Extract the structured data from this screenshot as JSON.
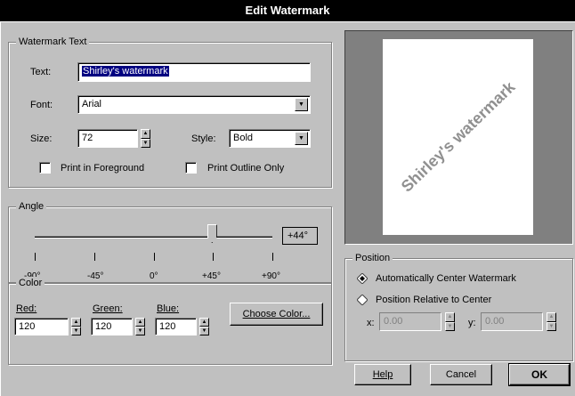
{
  "window": {
    "title": "Edit Watermark"
  },
  "watermark_text": {
    "group_label": "Watermark Text",
    "text_label": "Text:",
    "text_value": "Shirley's watermark",
    "font_label": "Font:",
    "font_value": "Arial",
    "size_label": "Size:",
    "size_value": "72",
    "style_label": "Style:",
    "style_value": "Bold",
    "print_foreground_label": "Print in Foreground",
    "print_foreground_checked": false,
    "print_outline_label": "Print Outline Only",
    "print_outline_checked": false
  },
  "angle": {
    "group_label": "Angle",
    "value_display": "+44°",
    "value": 44,
    "min": -90,
    "max": 90,
    "tick_labels": [
      "-90°",
      "-45°",
      "0°",
      "+45°",
      "+90°"
    ]
  },
  "color": {
    "group_label": "Color",
    "red_label": "Red:",
    "red_value": "120",
    "green_label": "Green:",
    "green_value": "120",
    "blue_label": "Blue:",
    "blue_value": "120",
    "choose_button": "Choose Color..."
  },
  "preview": {
    "text": "Shirley's watermark"
  },
  "position": {
    "group_label": "Position",
    "auto_center_label": "Automatically Center Watermark",
    "relative_label": "Position Relative to Center",
    "selected": "auto_center",
    "x_label": "x:",
    "x_value": "0.00",
    "y_label": "y:",
    "y_value": "0.00"
  },
  "buttons": {
    "help": "Help",
    "cancel": "Cancel",
    "ok": "OK"
  },
  "colors": {
    "title_bg": "#000000",
    "dialog_bg": "#c0c0c0",
    "selection": "#000080",
    "preview_bg": "#808080"
  }
}
